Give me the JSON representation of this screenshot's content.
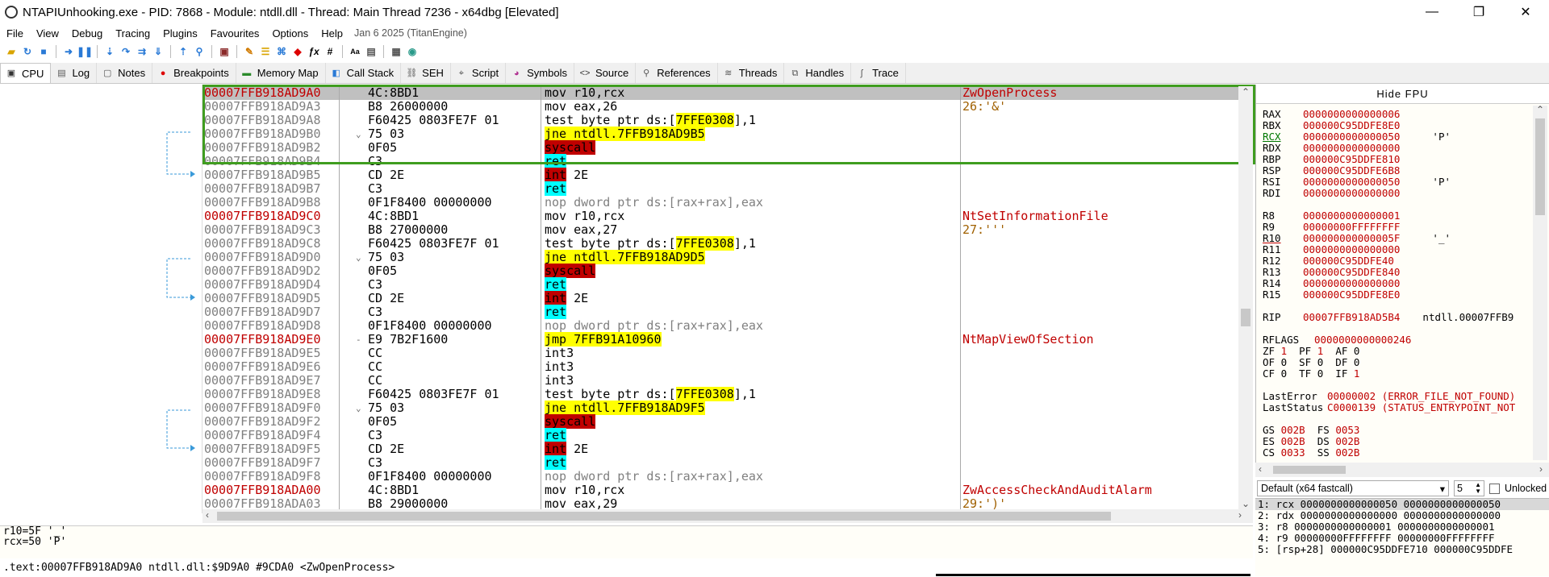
{
  "window": {
    "title": "NTAPIUnhooking.exe - PID: 7868 - Module: ntdll.dll - Thread: Main Thread 7236 - x64dbg [Elevated]",
    "controls": [
      "—",
      "❐",
      "✕"
    ]
  },
  "menu": {
    "items": [
      "File",
      "View",
      "Debug",
      "Tracing",
      "Plugins",
      "Favourites",
      "Options",
      "Help"
    ],
    "date": "Jan 6 2025 (TitanEngine)"
  },
  "tabs": [
    {
      "label": "CPU",
      "icon": "cpu-icon"
    },
    {
      "label": "Log",
      "icon": "log-icon"
    },
    {
      "label": "Notes",
      "icon": "notes-icon"
    },
    {
      "label": "Breakpoints",
      "icon": "breakpoint-icon"
    },
    {
      "label": "Memory Map",
      "icon": "memory-icon"
    },
    {
      "label": "Call Stack",
      "icon": "callstack-icon"
    },
    {
      "label": "SEH",
      "icon": "seh-icon"
    },
    {
      "label": "Script",
      "icon": "script-icon"
    },
    {
      "label": "Symbols",
      "icon": "symbols-icon"
    },
    {
      "label": "Source",
      "icon": "source-icon"
    },
    {
      "label": "References",
      "icon": "search-icon"
    },
    {
      "label": "Threads",
      "icon": "threads-icon"
    },
    {
      "label": "Handles",
      "icon": "handles-icon"
    },
    {
      "label": "Trace",
      "icon": "trace-icon"
    }
  ],
  "disasm": [
    {
      "addr": "00007FFB918AD9A0",
      "bytes": "4C:8BD1",
      "instr": "mov r10,rcx",
      "cmt": "ZwOpenProcess"
    },
    {
      "addr": "00007FFB918AD9A3",
      "bytes": "B8 26000000",
      "instr": "mov eax,26",
      "cmt": "26:'&'"
    },
    {
      "addr": "00007FFB918AD9A8",
      "bytes": "F60425 0803FE7F 01",
      "instr": "test byte ptr ds:[7FFE0308],1",
      "cmt": ""
    },
    {
      "addr": "00007FFB918AD9B0",
      "bytes": "75 03",
      "instr": "jne ntdll.7FFB918AD9B5",
      "cmt": ""
    },
    {
      "addr": "00007FFB918AD9B2",
      "bytes": "0F05",
      "instr": "syscall",
      "cmt": ""
    },
    {
      "addr": "00007FFB918AD9B4",
      "bytes": "C3",
      "instr": "ret",
      "cmt": ""
    },
    {
      "addr": "00007FFB918AD9B5",
      "bytes": "CD 2E",
      "instr": "int 2E",
      "cmt": ""
    },
    {
      "addr": "00007FFB918AD9B7",
      "bytes": "C3",
      "instr": "ret",
      "cmt": ""
    },
    {
      "addr": "00007FFB918AD9B8",
      "bytes": "0F1F8400 00000000",
      "instr": "nop dword ptr ds:[rax+rax],eax",
      "cmt": ""
    },
    {
      "addr": "00007FFB918AD9C0",
      "bytes": "4C:8BD1",
      "instr": "mov r10,rcx",
      "cmt": "NtSetInformationFile"
    },
    {
      "addr": "00007FFB918AD9C3",
      "bytes": "B8 27000000",
      "instr": "mov eax,27",
      "cmt": "27:'''"
    },
    {
      "addr": "00007FFB918AD9C8",
      "bytes": "F60425 0803FE7F 01",
      "instr": "test byte ptr ds:[7FFE0308],1",
      "cmt": ""
    },
    {
      "addr": "00007FFB918AD9D0",
      "bytes": "75 03",
      "instr": "jne ntdll.7FFB918AD9D5",
      "cmt": ""
    },
    {
      "addr": "00007FFB918AD9D2",
      "bytes": "0F05",
      "instr": "syscall",
      "cmt": ""
    },
    {
      "addr": "00007FFB918AD9D4",
      "bytes": "C3",
      "instr": "ret",
      "cmt": ""
    },
    {
      "addr": "00007FFB918AD9D5",
      "bytes": "CD 2E",
      "instr": "int 2E",
      "cmt": ""
    },
    {
      "addr": "00007FFB918AD9D7",
      "bytes": "C3",
      "instr": "ret",
      "cmt": ""
    },
    {
      "addr": "00007FFB918AD9D8",
      "bytes": "0F1F8400 00000000",
      "instr": "nop dword ptr ds:[rax+rax],eax",
      "cmt": ""
    },
    {
      "addr": "00007FFB918AD9E0",
      "bytes": "E9 7B2F1600",
      "instr": "jmp 7FFB91A10960",
      "cmt": "NtMapViewOfSection"
    },
    {
      "addr": "00007FFB918AD9E5",
      "bytes": "CC",
      "instr": "int3",
      "cmt": ""
    },
    {
      "addr": "00007FFB918AD9E6",
      "bytes": "CC",
      "instr": "int3",
      "cmt": ""
    },
    {
      "addr": "00007FFB918AD9E7",
      "bytes": "CC",
      "instr": "int3",
      "cmt": ""
    },
    {
      "addr": "00007FFB918AD9E8",
      "bytes": "F60425 0803FE7F 01",
      "instr": "test byte ptr ds:[7FFE0308],1",
      "cmt": ""
    },
    {
      "addr": "00007FFB918AD9F0",
      "bytes": "75 03",
      "instr": "jne ntdll.7FFB918AD9F5",
      "cmt": ""
    },
    {
      "addr": "00007FFB918AD9F2",
      "bytes": "0F05",
      "instr": "syscall",
      "cmt": ""
    },
    {
      "addr": "00007FFB918AD9F4",
      "bytes": "C3",
      "instr": "ret",
      "cmt": ""
    },
    {
      "addr": "00007FFB918AD9F5",
      "bytes": "CD 2E",
      "instr": "int 2E",
      "cmt": ""
    },
    {
      "addr": "00007FFB918AD9F7",
      "bytes": "C3",
      "instr": "ret",
      "cmt": ""
    },
    {
      "addr": "00007FFB918AD9F8",
      "bytes": "0F1F8400 00000000",
      "instr": "nop dword ptr ds:[rax+rax],eax",
      "cmt": ""
    },
    {
      "addr": "00007FFB918ADA00",
      "bytes": "4C:8BD1",
      "instr": "mov r10,rcx",
      "cmt": "ZwAccessCheckAndAuditAlarm"
    },
    {
      "addr": "00007FFB918ADA03",
      "bytes": "B8 29000000",
      "instr": "mov eax,29",
      "cmt": "29:')'"
    }
  ],
  "info": {
    "line1": "r10=5F '_'",
    "line2": "rcx=50 'P'",
    "status": ".text:00007FFB918AD9A0 ntdll.dll:$9D9A0 #9CDA0 <ZwOpenProcess>"
  },
  "registers": {
    "hide_fpu": "Hide FPU",
    "gp1": [
      {
        "name": "RAX",
        "value": "0000000000000006",
        "comment": ""
      },
      {
        "name": "RBX",
        "value": "000000C95DDFE8E0",
        "comment": ""
      },
      {
        "name": "RCX",
        "value": "0000000000000050",
        "comment": "'P'"
      },
      {
        "name": "RDX",
        "value": "0000000000000000",
        "comment": ""
      },
      {
        "name": "RBP",
        "value": "000000C95DDFE810",
        "comment": ""
      },
      {
        "name": "RSP",
        "value": "000000C95DDFE6B8",
        "comment": ""
      },
      {
        "name": "RSI",
        "value": "0000000000000050",
        "comment": "'P'"
      },
      {
        "name": "RDI",
        "value": "0000000000000000",
        "comment": ""
      }
    ],
    "gp2": [
      {
        "name": "R8",
        "value": "0000000000000001",
        "comment": ""
      },
      {
        "name": "R9",
        "value": "00000000FFFFFFFF",
        "comment": ""
      },
      {
        "name": "R10",
        "value": "000000000000005F",
        "comment": "'_'"
      },
      {
        "name": "R11",
        "value": "0000000000000000",
        "comment": ""
      },
      {
        "name": "R12",
        "value": "000000C95DDFE40",
        "comment": ""
      },
      {
        "name": "R13",
        "value": "000000C95DDFE840",
        "comment": ""
      },
      {
        "name": "R14",
        "value": "0000000000000000",
        "comment": ""
      },
      {
        "name": "R15",
        "value": "000000C95DDFE8E0",
        "comment": ""
      }
    ],
    "rip": {
      "name": "RIP",
      "value": "00007FFB918AD5B4",
      "comment": "ntdll.00007FFB9"
    },
    "rflags": {
      "name": "RFLAGS",
      "value": "0000000000000246"
    },
    "flags": [
      "ZF 1  PF 1  AF 0",
      "OF 0  SF 0  DF 0",
      "CF 0  TF 0  IF 1"
    ],
    "lasterror": {
      "label": "LastError",
      "value": "00000002 (ERROR_FILE_NOT_FOUND)"
    },
    "laststatus": {
      "label": "LastStatus",
      "value": "C0000139 (STATUS_ENTRYPOINT_NOT"
    },
    "segs": [
      "GS 002B  FS 0053",
      "ES 002B  DS 002B",
      "CS 0033  SS 002B"
    ]
  },
  "callconv": {
    "selected": "Default (x64 fastcall)",
    "count": "5",
    "unlocked": "Unlocked"
  },
  "stack_args": [
    "1: rcx 0000000000000050 0000000000000050",
    "2: rdx 0000000000000000 0000000000000000",
    "3: r8 0000000000000001 0000000000000001",
    "4: r9 00000000FFFFFFFF 00000000FFFFFFFF",
    "5: [rsp+28] 000000C95DDFE710 000000C95DDFE"
  ]
}
